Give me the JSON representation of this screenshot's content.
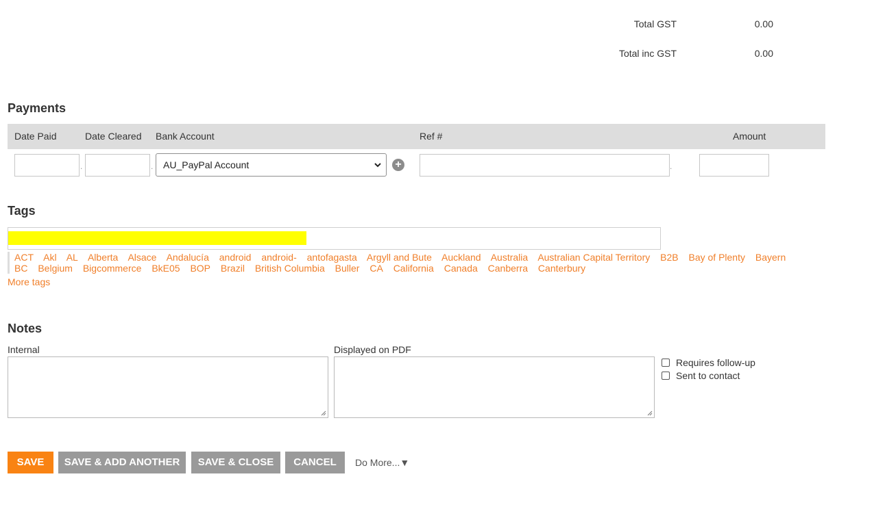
{
  "totals": {
    "gst_label": "Total GST",
    "gst_value": "0.00",
    "inc_label": "Total inc GST",
    "inc_value": "0.00"
  },
  "payments": {
    "heading": "Payments",
    "columns": {
      "date_paid": "Date Paid",
      "date_cleared": "Date Cleared",
      "bank_account": "Bank Account",
      "ref": "Ref #",
      "amount": "Amount"
    },
    "bank_account_selected": "AU_PayPal Account"
  },
  "tags": {
    "heading": "Tags",
    "items": [
      "ACT",
      "Akl",
      "AL",
      "Alberta",
      "Alsace",
      "Andalucía",
      "android",
      "android-",
      "antofagasta",
      "Argyll and Bute",
      "Auckland",
      "Australia",
      "Australian Capital Territory",
      "B2B",
      "Bay of Plenty",
      "Bayern",
      "BC",
      "Belgium",
      "Bigcommerce",
      "BkE05",
      "BOP",
      "Brazil",
      "British Columbia",
      "Buller",
      "CA",
      "California",
      "Canada",
      "Canberra",
      "Canterbury"
    ],
    "more_label": "More tags",
    "link_color": "#f07f2a",
    "highlight_color": "#ffff00"
  },
  "notes": {
    "heading": "Notes",
    "internal_label": "Internal",
    "pdf_label": "Displayed on PDF",
    "requires_followup": "Requires follow-up",
    "sent_to_contact": "Sent to contact"
  },
  "actions": {
    "save": "SAVE",
    "save_add": "SAVE & ADD ANOTHER",
    "save_close": "SAVE & CLOSE",
    "cancel": "CANCEL",
    "do_more": "Do More...▼",
    "accent_color": "#f98313",
    "secondary_color": "#9a9a9a"
  }
}
